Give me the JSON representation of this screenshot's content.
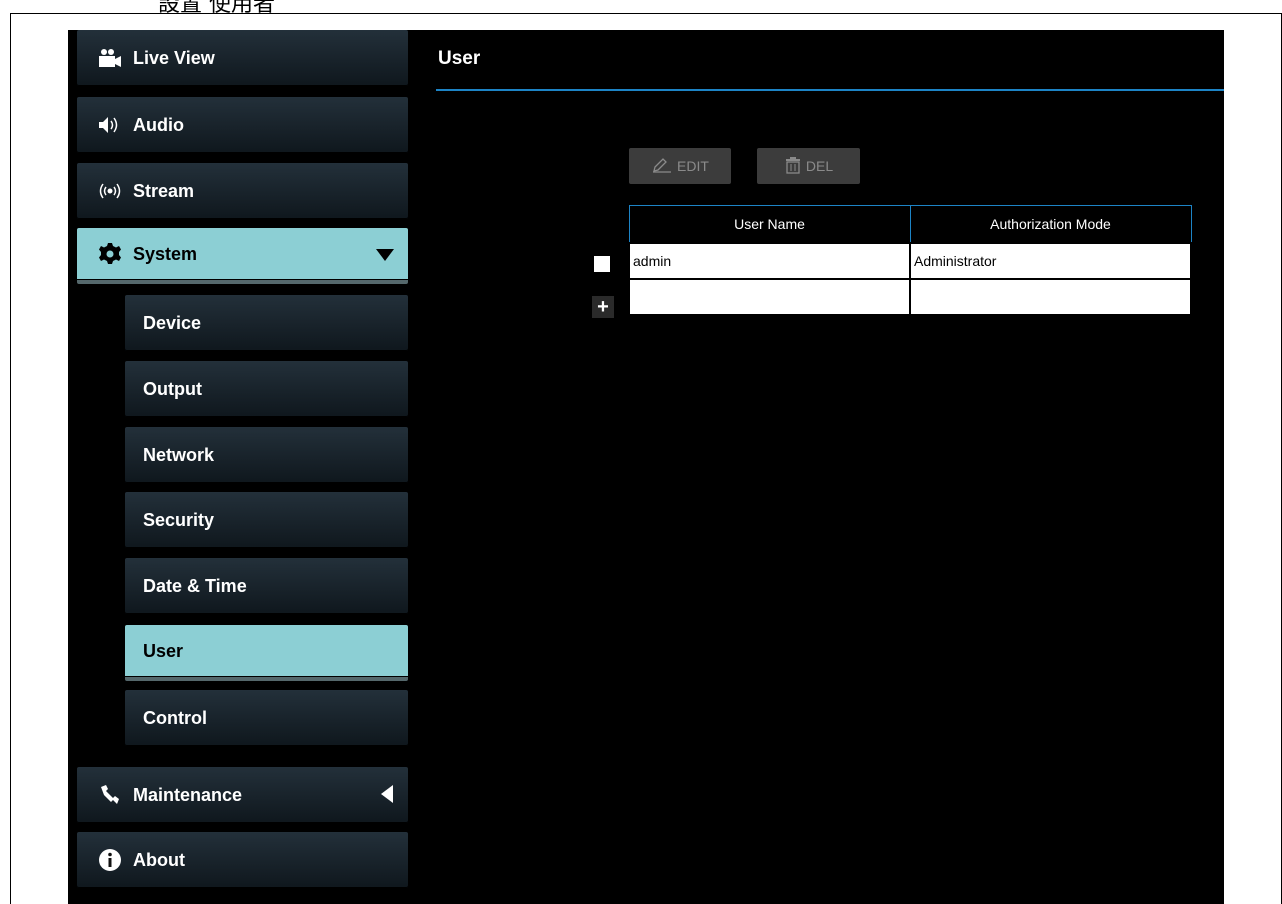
{
  "doc_heading": "設置 使用者",
  "sidebar": {
    "items": [
      {
        "label": "Live View",
        "icon": "video-camera-icon"
      },
      {
        "label": "Audio",
        "icon": "speaker-icon"
      },
      {
        "label": "Stream",
        "icon": "broadcast-icon"
      },
      {
        "label": "System",
        "icon": "gear-icon",
        "expanded": true
      },
      {
        "label": "Device"
      },
      {
        "label": "Output"
      },
      {
        "label": "Network"
      },
      {
        "label": "Security"
      },
      {
        "label": "Date & Time"
      },
      {
        "label": "User",
        "active": true
      },
      {
        "label": "Control"
      },
      {
        "label": "Maintenance",
        "icon": "wrench-icon",
        "expanded": false
      },
      {
        "label": "About",
        "icon": "info-icon"
      }
    ]
  },
  "main": {
    "title": "User",
    "toolbar": {
      "edit_label": "EDIT",
      "del_label": "DEL"
    },
    "table": {
      "columns": [
        "User Name",
        "Authorization Mode"
      ],
      "rows": [
        {
          "user_name": "admin",
          "mode": "Administrator"
        }
      ]
    },
    "add_symbol": "+"
  },
  "colors": {
    "accent": "#1d84c6",
    "active_nav": "#8ccfd4",
    "background": "#000000"
  }
}
